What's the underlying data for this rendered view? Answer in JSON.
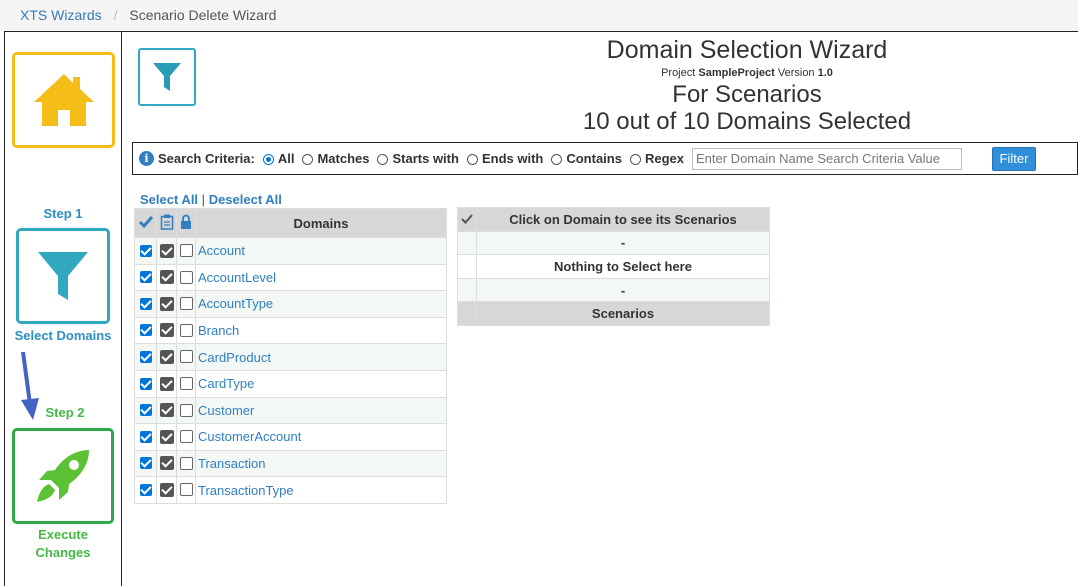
{
  "breadcrumb": {
    "root": "XTS Wizards",
    "separator": "/",
    "current": "Scenario Delete Wizard"
  },
  "sidebar": {
    "step1_label": "Step 1",
    "step1_action": "Select Domains",
    "step2_label": "Step 2",
    "step2_action_line1": "Execute",
    "step2_action_line2": "Changes",
    "icons": [
      "home-icon",
      "filter-icon",
      "rocket-icon"
    ]
  },
  "header": {
    "title": "Domain Selection Wizard",
    "project_prefix": "Project",
    "project_name": "SampleProject",
    "version_prefix": "Version",
    "version": "1.0",
    "for_line": "For Scenarios",
    "count_line": "10 out of 10 Domains Selected"
  },
  "search": {
    "label": "Search Criteria:",
    "options": [
      "All",
      "Matches",
      "Starts with",
      "Ends with",
      "Contains",
      "Regex"
    ],
    "selected": "All",
    "placeholder": "Enter Domain Name Search Criteria Value",
    "button": "Filter"
  },
  "selection": {
    "select_all": "Select All",
    "separator": "|",
    "deselect_all": "Deselect All"
  },
  "domains": {
    "header": "Domains",
    "rows": [
      "Account",
      "AccountLevel",
      "AccountType",
      "Branch",
      "CardProduct",
      "CardType",
      "Customer",
      "CustomerAccount",
      "Transaction",
      "TransactionType"
    ]
  },
  "scenarios_panel": {
    "header": "Click on Domain to see its Scenarios",
    "rows": [
      "-",
      "Nothing to Select here",
      "-"
    ],
    "footer": "Scenarios"
  },
  "colors": {
    "home": "#f5bd18",
    "filter": "#31a8c0",
    "rocket": "#2ea946",
    "link": "#2f7fc1"
  }
}
